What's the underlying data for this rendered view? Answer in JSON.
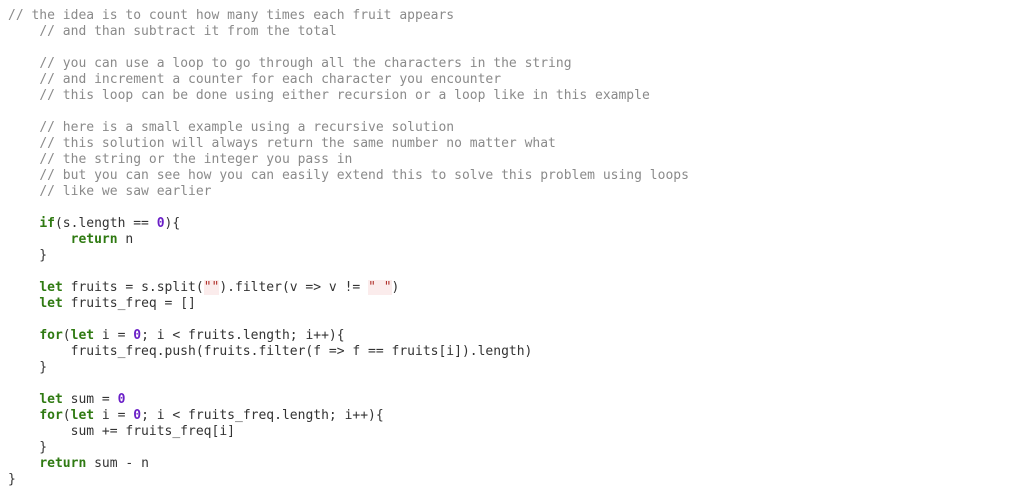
{
  "colors": {
    "background": "#ffffff",
    "text": "#333333",
    "comment": "#8a8a8a",
    "keyword": "#2f7a12",
    "number": "#6a1fc7",
    "string": "#b0302a",
    "string_background": "#fbecec"
  },
  "code": {
    "lines": [
      [
        {
          "t": "comment",
          "v": "// the idea is to count how many times each fruit appears"
        }
      ],
      [
        {
          "t": "plain",
          "v": "    "
        },
        {
          "t": "comment",
          "v": "// and than subtract it from the total"
        }
      ],
      [],
      [
        {
          "t": "plain",
          "v": "    "
        },
        {
          "t": "comment",
          "v": "// you can use a loop to go through all the characters in the string"
        }
      ],
      [
        {
          "t": "plain",
          "v": "    "
        },
        {
          "t": "comment",
          "v": "// and increment a counter for each character you encounter"
        }
      ],
      [
        {
          "t": "plain",
          "v": "    "
        },
        {
          "t": "comment",
          "v": "// this loop can be done using either recursion or a loop like in this example"
        }
      ],
      [],
      [
        {
          "t": "plain",
          "v": "    "
        },
        {
          "t": "comment",
          "v": "// here is a small example using a recursive solution"
        }
      ],
      [
        {
          "t": "plain",
          "v": "    "
        },
        {
          "t": "comment",
          "v": "// this solution will always return the same number no matter what"
        }
      ],
      [
        {
          "t": "plain",
          "v": "    "
        },
        {
          "t": "comment",
          "v": "// the string or the integer you pass in"
        }
      ],
      [
        {
          "t": "plain",
          "v": "    "
        },
        {
          "t": "comment",
          "v": "// but you can see how you can easily extend this to solve this problem using loops"
        }
      ],
      [
        {
          "t": "plain",
          "v": "    "
        },
        {
          "t": "comment",
          "v": "// like we saw earlier"
        }
      ],
      [],
      [
        {
          "t": "plain",
          "v": "    "
        },
        {
          "t": "kw",
          "v": "if"
        },
        {
          "t": "plain",
          "v": "(s.length == "
        },
        {
          "t": "num",
          "v": "0"
        },
        {
          "t": "plain",
          "v": "){"
        }
      ],
      [
        {
          "t": "plain",
          "v": "        "
        },
        {
          "t": "kw",
          "v": "return"
        },
        {
          "t": "plain",
          "v": " n"
        }
      ],
      [
        {
          "t": "plain",
          "v": "    }"
        }
      ],
      [],
      [
        {
          "t": "plain",
          "v": "    "
        },
        {
          "t": "kw",
          "v": "let"
        },
        {
          "t": "plain",
          "v": " fruits = s.split("
        },
        {
          "t": "str",
          "v": "\"\""
        },
        {
          "t": "plain",
          "v": ").filter(v => v != "
        },
        {
          "t": "str",
          "v": "\" \""
        },
        {
          "t": "plain",
          "v": ")"
        }
      ],
      [
        {
          "t": "plain",
          "v": "    "
        },
        {
          "t": "kw",
          "v": "let"
        },
        {
          "t": "plain",
          "v": " fruits_freq = []"
        }
      ],
      [],
      [
        {
          "t": "plain",
          "v": "    "
        },
        {
          "t": "kw",
          "v": "for"
        },
        {
          "t": "plain",
          "v": "("
        },
        {
          "t": "kw",
          "v": "let"
        },
        {
          "t": "plain",
          "v": " i = "
        },
        {
          "t": "num",
          "v": "0"
        },
        {
          "t": "plain",
          "v": "; i < fruits.length; i++){"
        }
      ],
      [
        {
          "t": "plain",
          "v": "        fruits_freq.push(fruits.filter(f => f == fruits[i]).length)"
        }
      ],
      [
        {
          "t": "plain",
          "v": "    }"
        }
      ],
      [],
      [
        {
          "t": "plain",
          "v": "    "
        },
        {
          "t": "kw",
          "v": "let"
        },
        {
          "t": "plain",
          "v": " sum = "
        },
        {
          "t": "num",
          "v": "0"
        }
      ],
      [
        {
          "t": "plain",
          "v": "    "
        },
        {
          "t": "kw",
          "v": "for"
        },
        {
          "t": "plain",
          "v": "("
        },
        {
          "t": "kw",
          "v": "let"
        },
        {
          "t": "plain",
          "v": " i = "
        },
        {
          "t": "num",
          "v": "0"
        },
        {
          "t": "plain",
          "v": "; i < fruits_freq.length; i++){"
        }
      ],
      [
        {
          "t": "plain",
          "v": "        sum += fruits_freq[i]"
        }
      ],
      [
        {
          "t": "plain",
          "v": "    }"
        }
      ],
      [
        {
          "t": "plain",
          "v": "    "
        },
        {
          "t": "kw",
          "v": "return"
        },
        {
          "t": "plain",
          "v": " sum - n"
        }
      ],
      [
        {
          "t": "plain",
          "v": "}"
        }
      ]
    ]
  }
}
